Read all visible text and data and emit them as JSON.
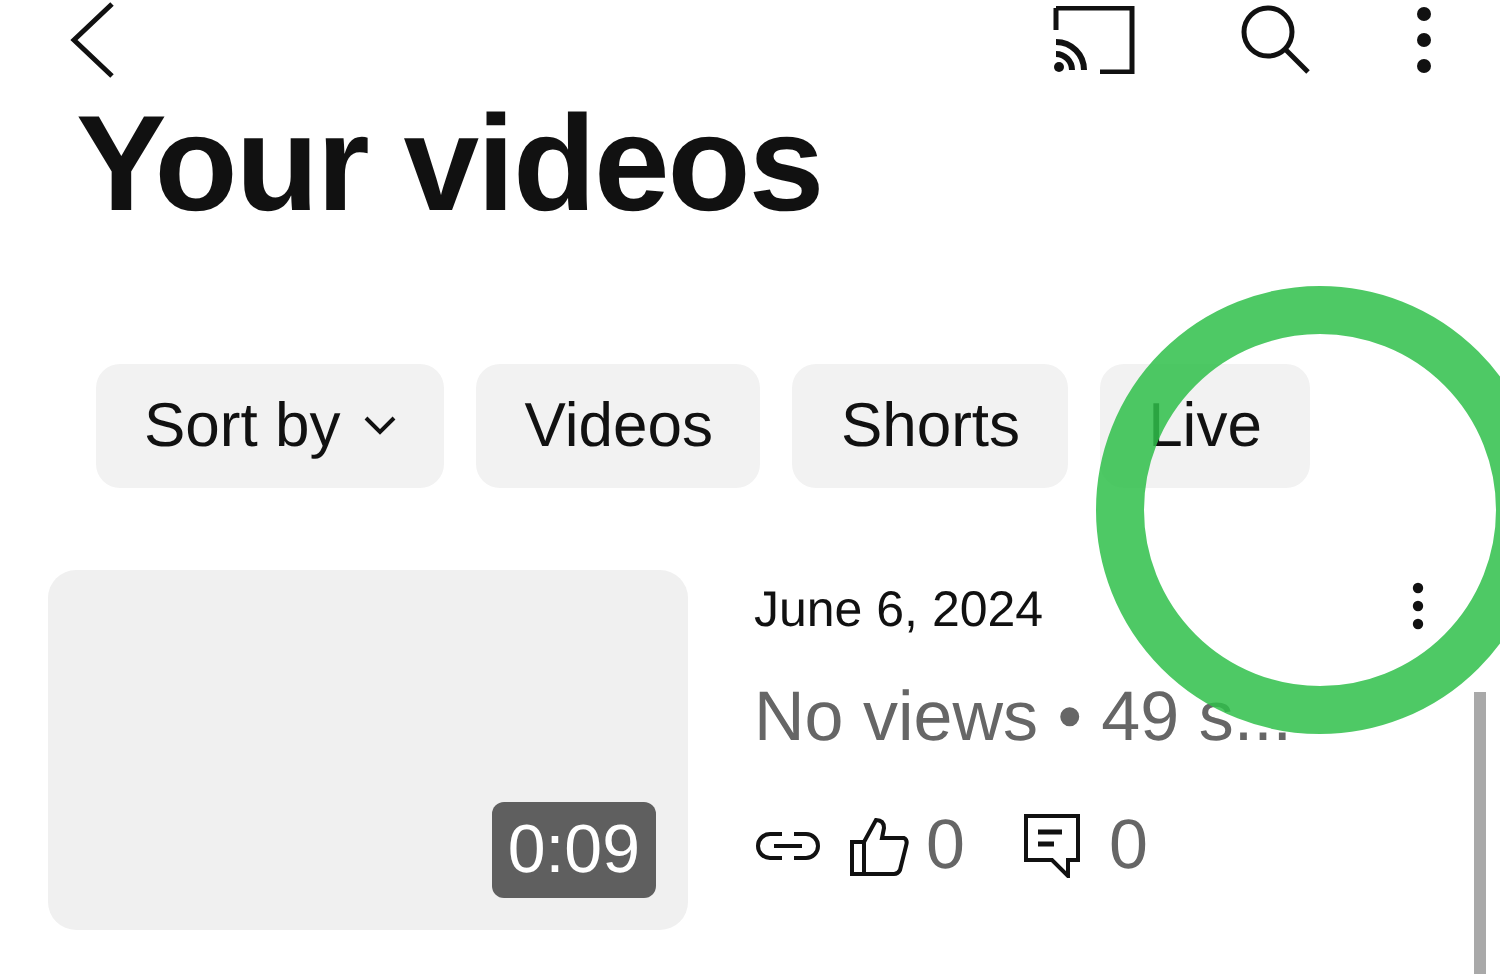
{
  "title": "Your videos",
  "chips": [
    {
      "label": "Sort by",
      "kind": "dropdown"
    },
    {
      "label": "Videos",
      "kind": "filter"
    },
    {
      "label": "Shorts",
      "kind": "filter"
    },
    {
      "label": "Live",
      "kind": "filter"
    }
  ],
  "videos": [
    {
      "duration": "0:09",
      "date": "June 6, 2024",
      "meta": "No views • 49 s...",
      "likes": "0",
      "comments": "0"
    }
  ]
}
